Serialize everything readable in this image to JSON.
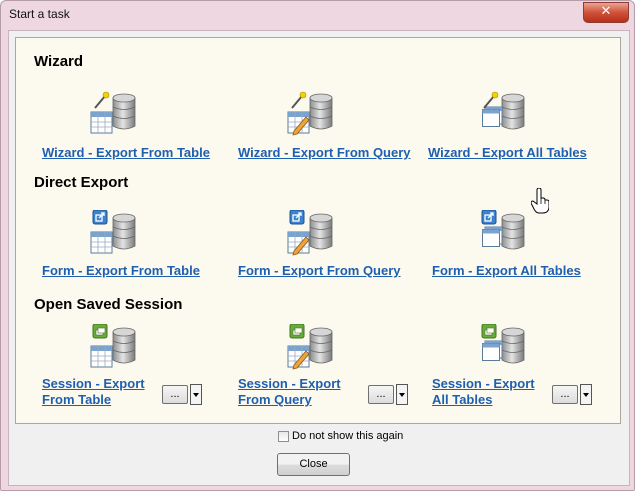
{
  "window": {
    "title": "Start a task",
    "close_symbol": "✕"
  },
  "sections": {
    "wizard": "Wizard",
    "direct": "Direct Export",
    "session": "Open Saved Session"
  },
  "tasks": {
    "wizard_table": "Wizard - Export From Table",
    "wizard_query": "Wizard - Export From Query",
    "wizard_all": "Wizard - Export All Tables",
    "form_table": "Form - Export From Table",
    "form_query": "Form - Export From Query",
    "form_all": "Form - Export All Tables",
    "session_table_1": "Session - Export",
    "session_table_2": "From Table",
    "session_query_1": "Session - Export",
    "session_query_2": "From Query",
    "session_all_1": "Session - Export",
    "session_all_2": "All Tables"
  },
  "session_buttons": {
    "dots": "..."
  },
  "footer": {
    "checkbox_label": "Do not show this again",
    "checkbox_checked": false,
    "close_label": "Close"
  },
  "colors": {
    "link": "#1f5fb0",
    "panel_bg": "#fcfaee",
    "frame": "#eed7e0"
  }
}
